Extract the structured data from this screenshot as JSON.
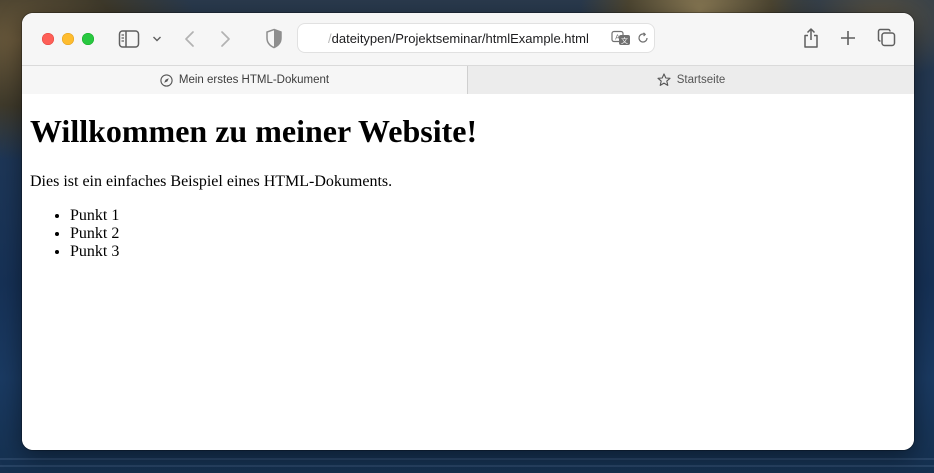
{
  "browser": {
    "address_bar": {
      "url_faded": "/",
      "url": "dateitypen/Projektseminar/htmlExample.html"
    },
    "icons": {
      "sidebar": "sidebar-icon",
      "chevron": "chevron-down-icon",
      "back": "chevron-left-icon",
      "forward": "chevron-right-icon",
      "privacy": "shield-icon",
      "translate": "translate-icon",
      "reload": "reload-icon",
      "share": "share-icon",
      "new_tab": "plus-icon",
      "tab_overview": "tabs-overview-icon"
    }
  },
  "tabs": [
    {
      "label": "Mein erstes HTML-Dokument",
      "icon": "compass-icon",
      "active": true
    },
    {
      "label": "Startseite",
      "icon": "star-icon",
      "active": false
    }
  ],
  "page": {
    "heading": "Willkommen zu meiner Website!",
    "paragraph": "Dies ist ein einfaches Beispiel eines HTML-Dokuments.",
    "list": [
      "Punkt 1",
      "Punkt 2",
      "Punkt 3"
    ]
  },
  "colors": {
    "close": "#fe5f57",
    "minimize": "#febc2e",
    "maximize": "#28c840"
  }
}
